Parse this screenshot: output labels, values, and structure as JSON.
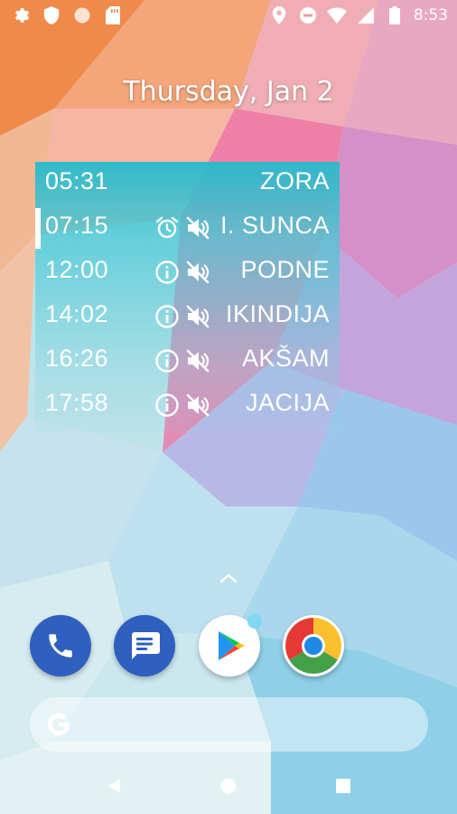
{
  "status_bar": {
    "left_icons": [
      "gear-icon",
      "shield-icon",
      "circle-icon",
      "sd-card-icon"
    ],
    "right_icons": [
      "location-pin-icon",
      "do-not-disturb-icon",
      "wifi-icon",
      "cell-signal-icon",
      "battery-icon"
    ],
    "time": "8:53"
  },
  "date": "Thursday, Jan 2",
  "widget": {
    "accent_color": "#26bacc",
    "rows": [
      {
        "time": "05:31",
        "name": "ZORA",
        "icon_left": "",
        "icon_right": "",
        "current": false
      },
      {
        "time": "07:15",
        "name": "I. SUNCA",
        "icon_left": "alarm-icon",
        "icon_right": "muted-speaker-icon",
        "current": true
      },
      {
        "time": "12:00",
        "name": "PODNE",
        "icon_left": "info-icon",
        "icon_right": "muted-speaker-icon",
        "current": false
      },
      {
        "time": "14:02",
        "name": "IKINDIJA",
        "icon_left": "info-icon",
        "icon_right": "muted-speaker-icon",
        "current": false
      },
      {
        "time": "16:26",
        "name": "AKŠAM",
        "icon_left": "info-icon",
        "icon_right": "muted-speaker-icon",
        "current": false
      },
      {
        "time": "17:58",
        "name": "JACIJA",
        "icon_left": "info-icon",
        "icon_right": "muted-speaker-icon",
        "current": false
      }
    ]
  },
  "dock": {
    "apps": [
      "phone-app-icon",
      "messages-app-icon",
      "play-store-app-icon",
      "chrome-app-icon"
    ]
  },
  "search": {
    "logo": "google-g-icon"
  },
  "nav": {
    "buttons": [
      "back-icon",
      "home-icon",
      "recents-icon"
    ]
  }
}
